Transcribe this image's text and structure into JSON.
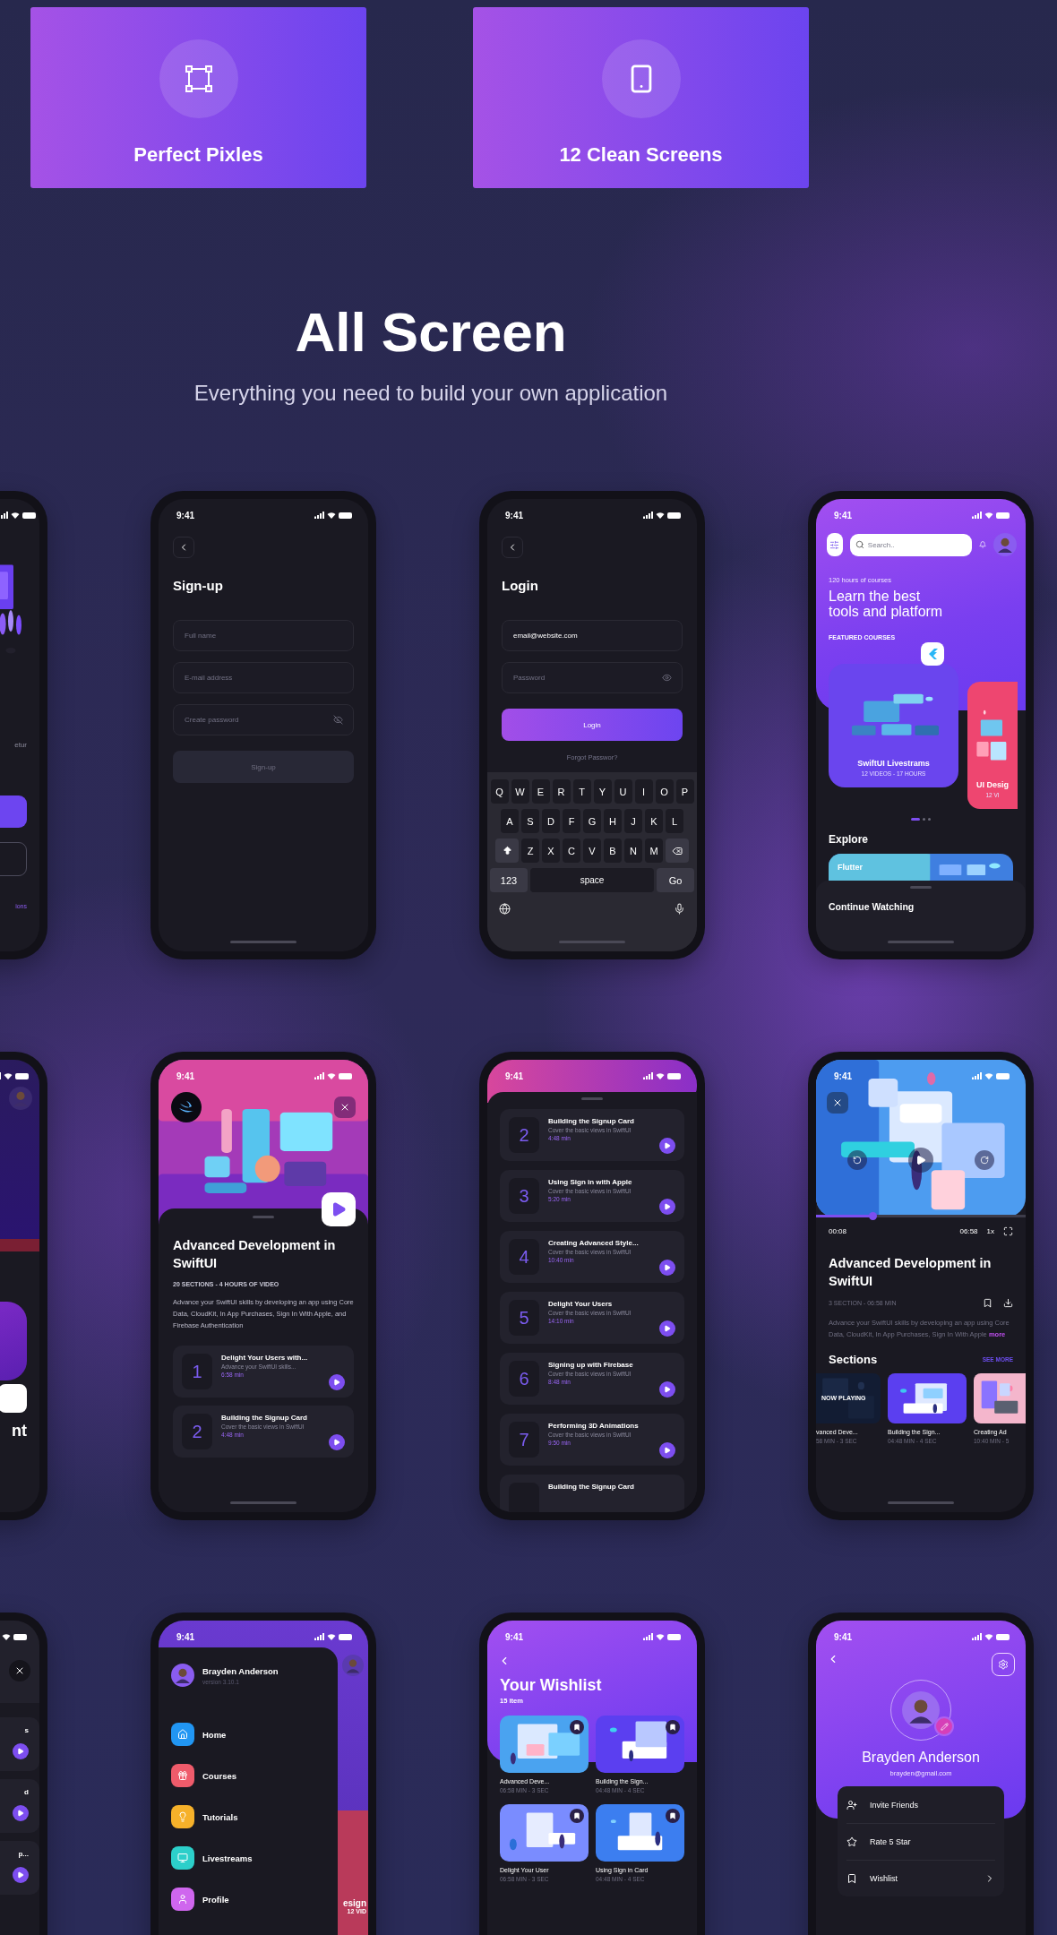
{
  "feature_cards": [
    {
      "label": "Perfect Pixles"
    },
    {
      "label": "12 Clean Screens"
    }
  ],
  "heading": {
    "title": "All Screen",
    "subtitle": "Everything you need to build your own application"
  },
  "onboarding": {
    "text": "etur",
    "link": "ions"
  },
  "signup": {
    "time": "9:41",
    "title": "Sign-up",
    "fields": [
      {
        "kind": "text",
        "placeholder": "Full name"
      },
      {
        "kind": "text",
        "placeholder": "E-mail address"
      },
      {
        "kind": "concealed",
        "placeholder": "Create password"
      }
    ],
    "button": {
      "label": "Sign-up",
      "disabled": true
    }
  },
  "login": {
    "time": "9:41",
    "title": "Login",
    "fields": [
      {
        "kind": "text",
        "value": "email@website.com"
      },
      {
        "kind": "password",
        "placeholder": "Password"
      }
    ],
    "button": {
      "label": "Login",
      "disabled": false
    },
    "link": "Forgot Passwor?",
    "keyboard": {
      "rows": [
        [
          "Q",
          "W",
          "E",
          "R",
          "T",
          "Y",
          "U",
          "I",
          "O",
          "P"
        ],
        [
          "A",
          "S",
          "D",
          "F",
          "G",
          "H",
          "J",
          "K",
          "L"
        ],
        [
          "Z",
          "X",
          "C",
          "V",
          "B",
          "N",
          "M"
        ]
      ],
      "numbers": "123",
      "space": "space",
      "go": "Go"
    }
  },
  "home": {
    "time": "9:41",
    "search": {
      "placeholder": "Search.."
    },
    "eyebrow": "120 hours of courses",
    "headline": "Learn the best tools and platform",
    "section": "FEATURED COURSES",
    "courses": [
      {
        "title": "SwiftUI Livestrams",
        "meta": "12 VIDEOS - 17 HOURS",
        "color": "#6a45ee"
      },
      {
        "title": "UI Desig",
        "meta": "12 VI",
        "color": "#ee4670"
      }
    ],
    "dots": [
      {
        "selected": true
      },
      {
        "selected": false
      },
      {
        "selected": false
      }
    ],
    "explore": "Explore",
    "explore_card": "Flutter",
    "sheet": "Continue Watching"
  },
  "course_preview": {
    "text": "nt"
  },
  "course": {
    "time": "9:41",
    "title": "Advanced Development in SwiftUI",
    "meta": "20 SECTIONS - 4 HOURS OF VIDEO",
    "description": "Advance your SwiftUI skills by developing an app using Core Data, CloudKit, In App Purchases, Sign In With Apple, and Firebase Authentication",
    "lessons": [
      {
        "number": "1",
        "title": "Delight Your Users with...",
        "subtitle": "Advance your SwiftUI skills...",
        "duration": "6:58 min"
      },
      {
        "number": "2",
        "title": "Building the Signup Card",
        "subtitle": "Cover the basic views in SwiftUI",
        "duration": "4:48 min"
      }
    ]
  },
  "lesson_list": {
    "time": "9:41",
    "lessons": [
      {
        "number": "2",
        "title": "Building the Signup Card",
        "subtitle": "Cover the basic views in SwiftUI",
        "duration": "4:48 min"
      },
      {
        "number": "3",
        "title": "Using Sign in with Apple",
        "subtitle": "Cover the basic views in SwiftUI",
        "duration": "5:20 min"
      },
      {
        "number": "4",
        "title": "Creating Advanced Style...",
        "subtitle": "Cover the basic views in SwiftUI",
        "duration": "10:40 min"
      },
      {
        "number": "5",
        "title": "Delight Your Users",
        "subtitle": "Cover the basic views in SwiftUI",
        "duration": "14:10 min"
      },
      {
        "number": "6",
        "title": "Signing up with Firebase",
        "subtitle": "Cover the basic views in SwiftUI",
        "duration": "8:48 min"
      },
      {
        "number": "7",
        "title": "Performing 3D Animations",
        "subtitle": "Cover the basic views in SwiftUI",
        "duration": "9:50 min"
      },
      {
        "title": "Building the Signup Card"
      }
    ]
  },
  "player": {
    "time": "9:41",
    "level": 0.27,
    "elapsed": "00:08",
    "total": "06:58",
    "speed": "1x",
    "title": "Advanced Development in SwiftUI",
    "meta": "3 SECTION - 06:58 MIN",
    "description": "Advance your SwiftUI skills by developing an app using Core Data, CloudKit, In App Purchases, Sign In With Apple",
    "more": "more",
    "sections_title": "Sections",
    "see_more": "SEE MORE",
    "sections": [
      {
        "title": "vanced Deve...",
        "meta": "58 MIN - 3 SEC",
        "badge": "NOW PLAYING",
        "selected": true
      },
      {
        "title": "Building the Sign...",
        "meta": "04:48 MIN - 4 SEC",
        "selected": false
      },
      {
        "title": "Creating Ad",
        "meta": "10:40 MIN - 5",
        "selected": false
      }
    ]
  },
  "lessons_partial": {
    "items": [
      {
        "title": "s"
      },
      {
        "title": "d"
      },
      {
        "title": "p..."
      }
    ]
  },
  "menu": {
    "time": "9:41",
    "user": {
      "name": "Brayden Anderson",
      "version": "version 3.10.1"
    },
    "items": [
      {
        "label": "Home",
        "color": "#2196f3"
      },
      {
        "label": "Courses",
        "color": "#ef5b6b"
      },
      {
        "label": "Tutorials",
        "color": "#f6b12a"
      },
      {
        "label": "Livestreams",
        "color": "#2ccfca"
      },
      {
        "label": "Profile",
        "color": "#cf66ee"
      }
    ],
    "behind": [
      "esign",
      "12 VID"
    ]
  },
  "wishlist": {
    "time": "9:41",
    "title": "Your Wishlist",
    "count": "15 item",
    "items": [
      {
        "title": "Advanced Deve...",
        "meta": "06:58 MIN - 3 SEC"
      },
      {
        "title": "Building the Sign...",
        "meta": "04:48 MIN - 4 SEC"
      },
      {
        "title": "Delight Your User",
        "meta": "06:58 MIN - 3 SEC"
      },
      {
        "title": "Using Sign in Card",
        "meta": "04:48 MIN - 4 SEC"
      }
    ]
  },
  "profile": {
    "time": "9:41",
    "name": "Brayden Anderson",
    "email": "brayden@gmail.com",
    "items": [
      {
        "label": "Invite Friends",
        "has_arrow": false
      },
      {
        "label": "Rate 5 Star",
        "has_arrow": false
      },
      {
        "label": "Wishlist",
        "has_arrow": true
      }
    ]
  }
}
